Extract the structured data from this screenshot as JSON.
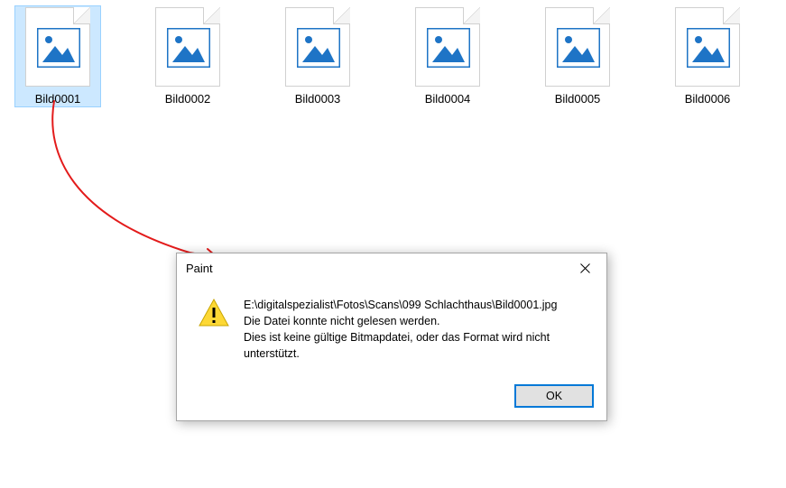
{
  "files": [
    {
      "label": "Bild0001",
      "selected": true
    },
    {
      "label": "Bild0002",
      "selected": false
    },
    {
      "label": "Bild0003",
      "selected": false
    },
    {
      "label": "Bild0004",
      "selected": false
    },
    {
      "label": "Bild0005",
      "selected": false
    },
    {
      "label": "Bild0006",
      "selected": false
    }
  ],
  "dialog": {
    "title": "Paint",
    "path": "E:\\digitalspezialist\\Fotos\\Scans\\099 Schlachthaus\\Bild0001.jpg",
    "line1": "Die Datei konnte nicht gelesen werden.",
    "line2": "Dies ist keine gültige Bitmapdatei, oder das Format wird nicht unterstützt.",
    "ok_label": "OK"
  }
}
